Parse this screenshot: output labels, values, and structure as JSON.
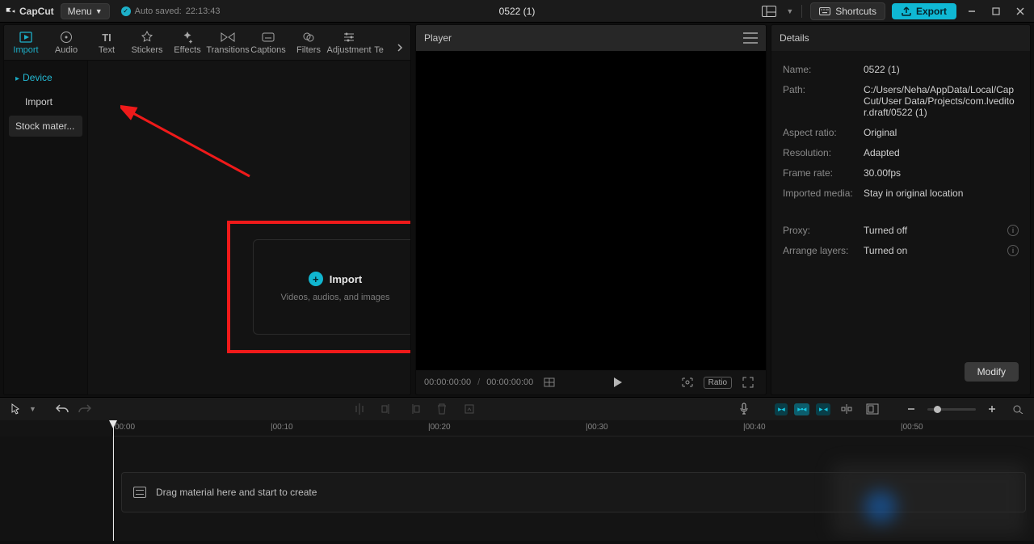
{
  "app": {
    "name": "CapCut",
    "menu_label": "Menu",
    "autosaved_label": "Auto saved:",
    "autosaved_time": "22:13:43",
    "project_title": "0522 (1)"
  },
  "titlebar": {
    "shortcuts_label": "Shortcuts",
    "export_label": "Export"
  },
  "tabs": [
    {
      "id": "import",
      "label": "Import"
    },
    {
      "id": "audio",
      "label": "Audio"
    },
    {
      "id": "text",
      "label": "Text"
    },
    {
      "id": "stickers",
      "label": "Stickers"
    },
    {
      "id": "effects",
      "label": "Effects"
    },
    {
      "id": "transitions",
      "label": "Transitions"
    },
    {
      "id": "captions",
      "label": "Captions"
    },
    {
      "id": "filters",
      "label": "Filters"
    },
    {
      "id": "adjustment",
      "label": "Adjustment"
    },
    {
      "id": "te",
      "label": "Te"
    }
  ],
  "left_sidebar": {
    "items": [
      {
        "id": "device",
        "label": "Device",
        "active": true,
        "bullet": true
      },
      {
        "id": "import",
        "label": "Import"
      },
      {
        "id": "stock",
        "label": "Stock mater...",
        "highlight": true
      }
    ]
  },
  "import_area": {
    "title": "Import",
    "subtitle": "Videos, audios, and images"
  },
  "player": {
    "title": "Player",
    "time_current": "00:00:00:00",
    "time_total": "00:00:00:00",
    "ratio_label": "Ratio"
  },
  "details": {
    "title": "Details",
    "rows": {
      "name": {
        "label": "Name:",
        "value": "0522 (1)"
      },
      "path": {
        "label": "Path:",
        "value": "C:/Users/Neha/AppData/Local/CapCut/User Data/Projects/com.lveditor.draft/0522 (1)"
      },
      "aspect": {
        "label": "Aspect ratio:",
        "value": "Original"
      },
      "resolution": {
        "label": "Resolution:",
        "value": "Adapted"
      },
      "framerate": {
        "label": "Frame rate:",
        "value": "30.00fps"
      },
      "imported": {
        "label": "Imported media:",
        "value": "Stay in original location"
      },
      "proxy": {
        "label": "Proxy:",
        "value": "Turned off"
      },
      "layers": {
        "label": "Arrange layers:",
        "value": "Turned on"
      }
    },
    "modify_label": "Modify"
  },
  "timeline": {
    "hint": "Drag material here and start to create",
    "marks": [
      "00:00",
      "|00:10",
      "|00:20",
      "|00:30",
      "|00:40",
      "|00:50"
    ]
  }
}
